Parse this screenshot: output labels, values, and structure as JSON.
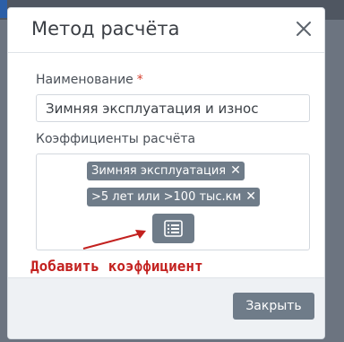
{
  "modal": {
    "title": "Метод расчёта",
    "close_icon": "close-icon"
  },
  "form": {
    "name_label": "Наименование",
    "required_mark": "*",
    "name_value": "Зимняя эксплуатация и износ",
    "coef_label": "Коэффициенты расчёта",
    "tags": [
      {
        "label": "Зимняя эксплуатация",
        "remove_symbol": "✕"
      },
      {
        "label": ">5 лет или >100 тыс.км",
        "remove_symbol": "✕"
      }
    ],
    "add_icon": "list-icon"
  },
  "annotation": {
    "text": "Добавить коэффициент",
    "color": "#c3211f"
  },
  "footer": {
    "close_label": "Закрыть"
  },
  "colors": {
    "tag_bg": "#6f7c89",
    "overlay": "#6c7480",
    "required": "#d6402f"
  }
}
